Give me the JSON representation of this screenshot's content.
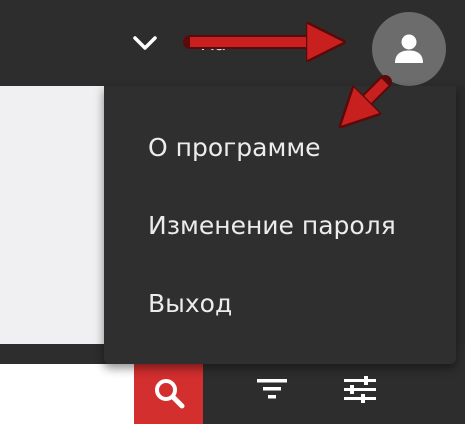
{
  "header": {
    "username": "Ка",
    "icons": {
      "dropdown": "chevron-down-icon",
      "avatar": "user-icon"
    }
  },
  "user_menu": {
    "items": [
      {
        "label": "О программе"
      },
      {
        "label": "Изменение пароля"
      },
      {
        "label": "Выход"
      }
    ]
  },
  "toolbar": {
    "search_value": "",
    "icons": {
      "search": "search-icon",
      "filter": "filter-icon",
      "settings": "sliders-icon"
    }
  },
  "annotation": {
    "arrow_color": "#c8201e",
    "arrows": [
      "arrow-right-icon",
      "arrow-down-left-icon"
    ]
  },
  "colors": {
    "dark": "#2d2d2d",
    "menu": "#2f2f2f",
    "light": "#f0f0f2",
    "accent": "#d32f2f",
    "avatar": "#6c6c6c"
  }
}
